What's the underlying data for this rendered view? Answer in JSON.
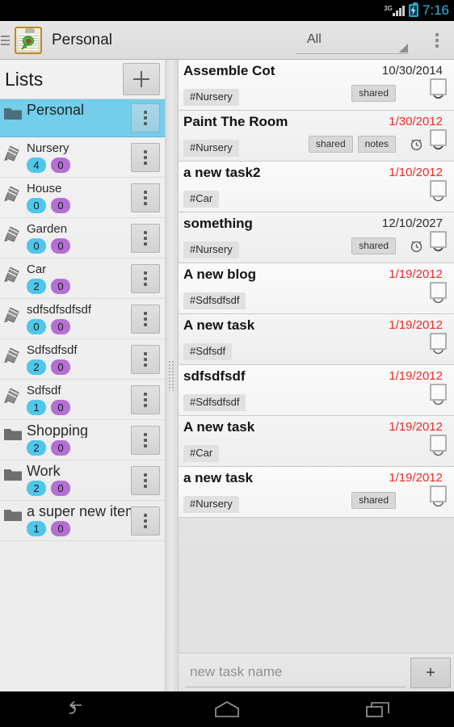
{
  "statusbar": {
    "network": "3G",
    "time": "7:16",
    "network_icon": "signal-3g-icon",
    "battery_icon": "battery-charging-icon"
  },
  "actionbar": {
    "drawer_icon": "drawer-menu-icon",
    "app_icon": "clipboard-app-icon",
    "title": "Personal",
    "filter_value": "All",
    "overflow_icon": "overflow-menu-icon"
  },
  "sidebar": {
    "header_title": "Lists",
    "add_label": "+",
    "add_icon": "plus-icon",
    "items": [
      {
        "name": "Personal",
        "icon": "folder-icon",
        "type": "group",
        "selected": true,
        "count_open": "",
        "count_done": ""
      },
      {
        "name": "Nursery",
        "icon": "note-icon",
        "type": "list",
        "selected": false,
        "count_open": "4",
        "count_done": "0"
      },
      {
        "name": "House",
        "icon": "note-icon",
        "type": "list",
        "selected": false,
        "count_open": "0",
        "count_done": "0"
      },
      {
        "name": "Garden",
        "icon": "note-icon",
        "type": "list",
        "selected": false,
        "count_open": "0",
        "count_done": "0"
      },
      {
        "name": "Car",
        "icon": "note-icon",
        "type": "list",
        "selected": false,
        "count_open": "2",
        "count_done": "0"
      },
      {
        "name": "sdfsdfsdfsdf",
        "icon": "note-icon",
        "type": "list",
        "selected": false,
        "count_open": "0",
        "count_done": "0"
      },
      {
        "name": "Sdfsdfsdf",
        "icon": "note-icon",
        "type": "list",
        "selected": false,
        "count_open": "2",
        "count_done": "0"
      },
      {
        "name": "Sdfsdf",
        "icon": "note-icon",
        "type": "list",
        "selected": false,
        "count_open": "1",
        "count_done": "0"
      },
      {
        "name": "Shopping",
        "icon": "folder-icon",
        "type": "group",
        "selected": false,
        "count_open": "2",
        "count_done": "0"
      },
      {
        "name": "Work",
        "icon": "folder-icon",
        "type": "group",
        "selected": false,
        "count_open": "2",
        "count_done": "0"
      },
      {
        "name": "a super new item",
        "icon": "folder-icon",
        "type": "group",
        "selected": false,
        "count_open": "1",
        "count_done": "0"
      }
    ]
  },
  "splitter": {
    "grip_icon": "drag-handle-icon"
  },
  "tasks": [
    {
      "title": "Assemble Cot",
      "date": "10/30/2014",
      "overdue": false,
      "tag": "#Nursery",
      "shared": "shared",
      "notes": "",
      "alarm": false,
      "repeat": true,
      "checked": false
    },
    {
      "title": "Paint The Room",
      "date": "1/30/2012",
      "overdue": true,
      "tag": "#Nursery",
      "shared": "shared",
      "notes": "notes",
      "alarm": true,
      "repeat": true,
      "checked": false
    },
    {
      "title": "a new task2",
      "date": "1/10/2012",
      "overdue": true,
      "tag": "#Car",
      "shared": "",
      "notes": "",
      "alarm": true,
      "repeat": false,
      "checked": false
    },
    {
      "title": "something",
      "date": "12/10/2027",
      "overdue": false,
      "tag": "#Nursery",
      "shared": "shared",
      "notes": "",
      "alarm": true,
      "repeat": true,
      "checked": false
    },
    {
      "title": "A new blog",
      "date": "1/19/2012",
      "overdue": true,
      "tag": "#Sdfsdfsdf",
      "shared": "",
      "notes": "",
      "alarm": true,
      "repeat": false,
      "checked": false
    },
    {
      "title": "A new task",
      "date": "1/19/2012",
      "overdue": true,
      "tag": "#Sdfsdf",
      "shared": "",
      "notes": "",
      "alarm": true,
      "repeat": false,
      "checked": false
    },
    {
      "title": "sdfsdfsdf",
      "date": "1/19/2012",
      "overdue": true,
      "tag": "#Sdfsdfsdf",
      "shared": "",
      "notes": "",
      "alarm": true,
      "repeat": false,
      "checked": false
    },
    {
      "title": "A new task",
      "date": "1/19/2012",
      "overdue": true,
      "tag": "#Car",
      "shared": "",
      "notes": "",
      "alarm": true,
      "repeat": false,
      "checked": false
    },
    {
      "title": "a new task",
      "date": "1/19/2012",
      "overdue": true,
      "tag": "#Nursery",
      "shared": "shared",
      "notes": "",
      "alarm": true,
      "repeat": false,
      "checked": false
    }
  ],
  "newtask": {
    "placeholder": "new task name",
    "value": "",
    "add_label": "+"
  },
  "navbar": {
    "back_icon": "back-icon",
    "home_icon": "home-icon",
    "recents_icon": "recents-icon"
  },
  "colors": {
    "accent_selected": "#74cdea",
    "badge_open": "#4fc6ea",
    "badge_done": "#b46fd4",
    "overdue": "#ef2a25",
    "status_time": "#32b5e5"
  }
}
